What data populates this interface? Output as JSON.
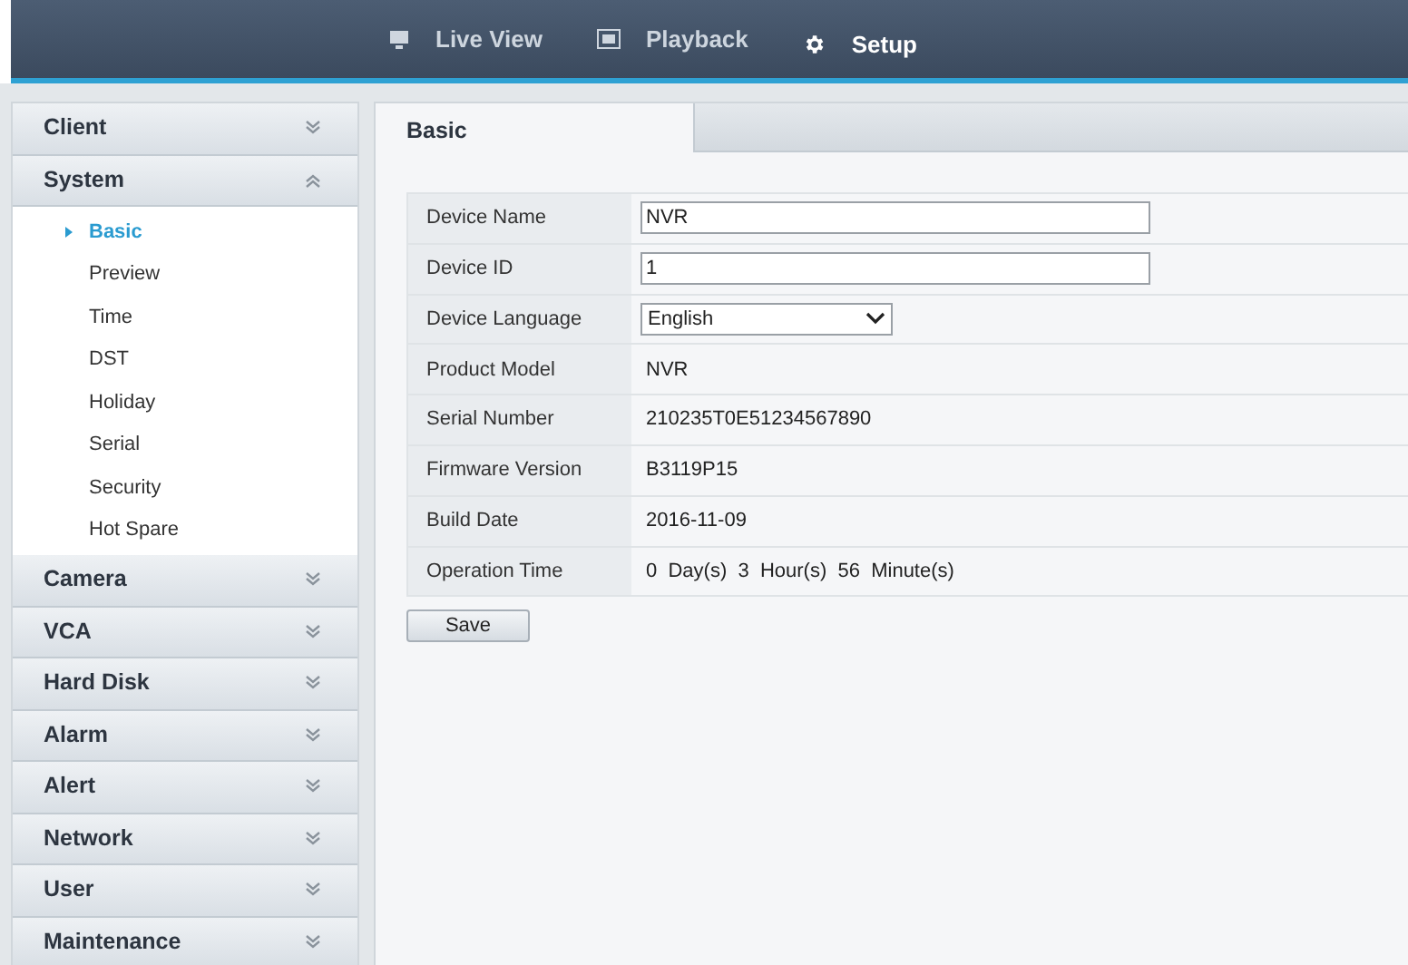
{
  "nav_tabs": [
    {
      "label": "Live View",
      "selected": false
    },
    {
      "label": "Playback",
      "selected": false
    },
    {
      "label": "Setup",
      "selected": true
    }
  ],
  "sidebar": {
    "sections": [
      {
        "title": "Client",
        "expanded": false
      },
      {
        "title": "System",
        "expanded": true,
        "items": [
          {
            "label": "Basic",
            "selected": true
          },
          {
            "label": "Preview",
            "selected": false
          },
          {
            "label": "Time",
            "selected": false
          },
          {
            "label": "DST",
            "selected": false
          },
          {
            "label": "Holiday",
            "selected": false
          },
          {
            "label": "Serial",
            "selected": false
          },
          {
            "label": "Security",
            "selected": false
          },
          {
            "label": "Hot Spare",
            "selected": false
          }
        ]
      },
      {
        "title": "Camera",
        "expanded": false
      },
      {
        "title": "VCA",
        "expanded": false
      },
      {
        "title": "Hard Disk",
        "expanded": false
      },
      {
        "title": "Alarm",
        "expanded": false
      },
      {
        "title": "Alert",
        "expanded": false
      },
      {
        "title": "Network",
        "expanded": false
      },
      {
        "title": "User",
        "expanded": false
      },
      {
        "title": "Maintenance",
        "expanded": false
      }
    ]
  },
  "page_tab": "Basic",
  "form": {
    "rows": [
      {
        "label": "Device Name",
        "kind": "input",
        "value": "NVR"
      },
      {
        "label": "Device ID",
        "kind": "input",
        "value": "1"
      },
      {
        "label": "Device Language",
        "kind": "select",
        "value": "English"
      },
      {
        "label": "Product Model",
        "kind": "text",
        "value": "NVR"
      },
      {
        "label": "Serial Number",
        "kind": "text",
        "value": "210235T0E51234567890"
      },
      {
        "label": "Firmware Version",
        "kind": "text",
        "value": "B3119P15"
      },
      {
        "label": "Build Date",
        "kind": "text",
        "value": "2016-11-09"
      },
      {
        "label": "Operation Time",
        "kind": "text",
        "value": "0  Day(s)  3  Hour(s)  56  Minute(s)"
      }
    ]
  },
  "save_button": "Save"
}
